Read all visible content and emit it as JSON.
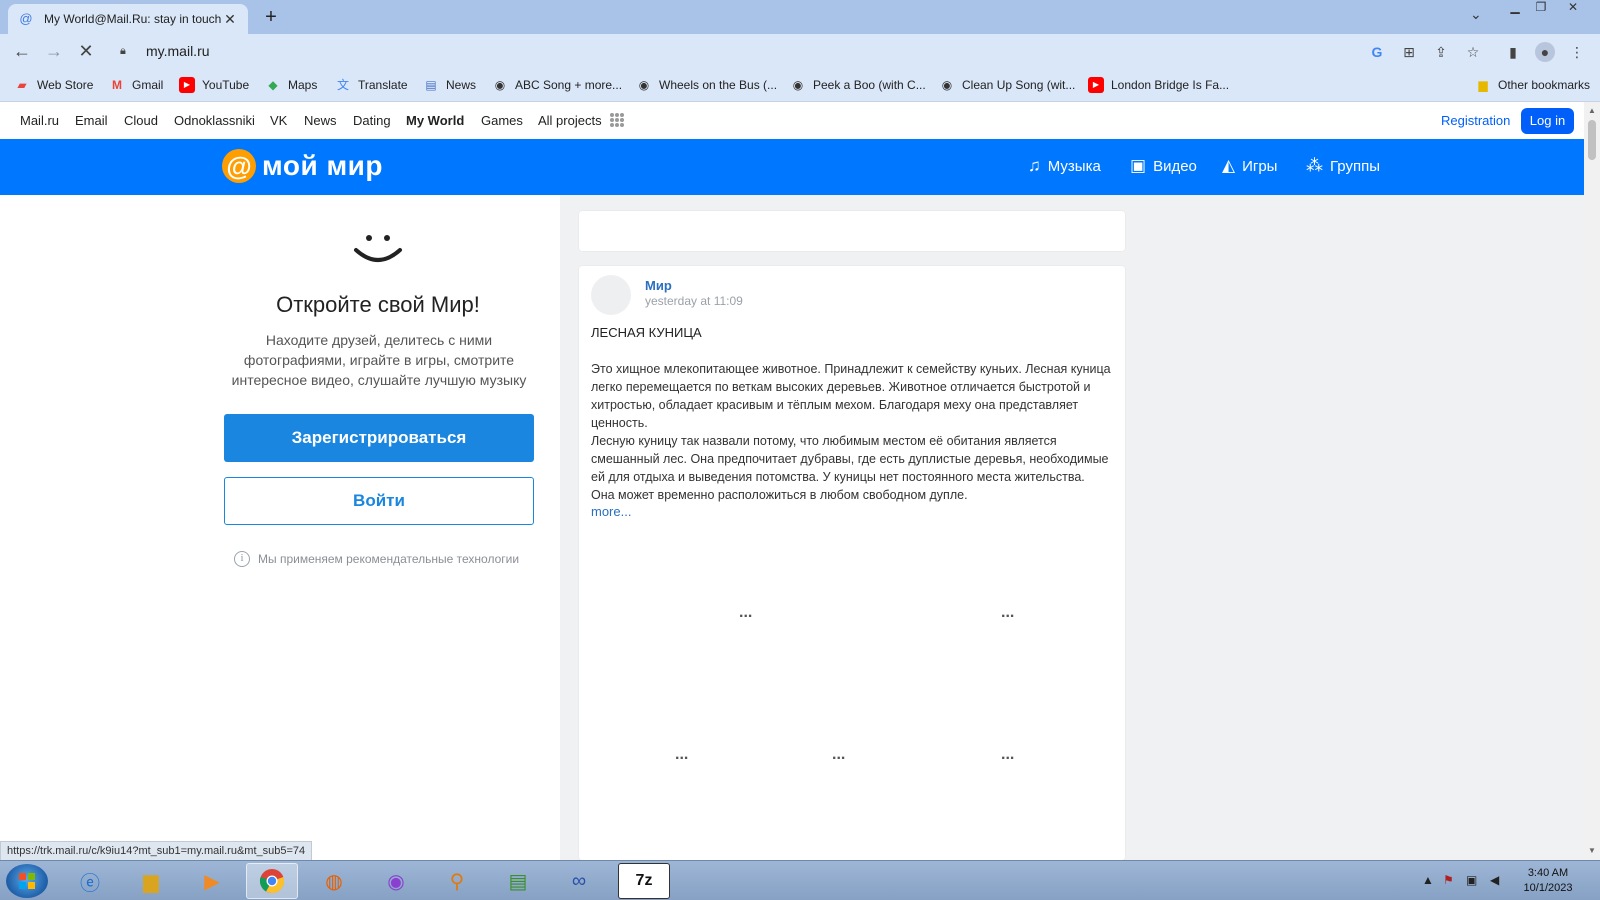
{
  "browser": {
    "tab_title": "My World@Mail.Ru: stay in touch",
    "url": "my.mail.ru",
    "bookmarks": [
      {
        "label": "Web Store",
        "icon": "web-store-icon"
      },
      {
        "label": "Gmail",
        "icon": "gmail-icon"
      },
      {
        "label": "YouTube",
        "icon": "youtube-icon"
      },
      {
        "label": "Maps",
        "icon": "maps-icon"
      },
      {
        "label": "Translate",
        "icon": "translate-icon"
      },
      {
        "label": "News",
        "icon": "news-icon"
      },
      {
        "label": "ABC Song + more...",
        "icon": "globe-icon"
      },
      {
        "label": "Wheels on the Bus (...",
        "icon": "globe-icon"
      },
      {
        "label": "Peek a Boo (with C...",
        "icon": "globe-icon"
      },
      {
        "label": "Clean Up Song (wit...",
        "icon": "globe-icon"
      },
      {
        "label": "London Bridge Is Fa...",
        "icon": "youtube-icon"
      }
    ],
    "other_bookmarks": "Other bookmarks",
    "status_url": "https://trk.mail.ru/c/k9iu14?mt_sub1=my.mail.ru&mt_sub5=74"
  },
  "portal": {
    "links": [
      "Mail.ru",
      "Email",
      "Cloud",
      "Odnoklassniki",
      "VK",
      "News",
      "Dating",
      "My World",
      "Games",
      "All projects"
    ],
    "registration": "Registration",
    "login": "Log in"
  },
  "header": {
    "logo_symbol": "@",
    "logo_text": "мой мир",
    "nav": [
      {
        "label": "Музыка",
        "icon": "music-note-icon"
      },
      {
        "label": "Видео",
        "icon": "video-icon"
      },
      {
        "label": "Игры",
        "icon": "gamepad-icon"
      },
      {
        "label": "Группы",
        "icon": "groups-icon"
      }
    ]
  },
  "promo": {
    "title": "Откройте свой Мир!",
    "text": "Находите друзей, делитесь с ними фотографиями, играйте в игры, смотрите интересное видео, слушайте лучшую музыку",
    "register_button": "Зарегистрироваться",
    "login_button": "Войти",
    "note": "Мы применяем рекомендательные технологии"
  },
  "post": {
    "author": "Мир",
    "time": "yesterday at 11:09",
    "title": "ЛЕСНАЯ КУНИЦА",
    "paragraph1": "Это хищное млекопитающее животное. Принадлежит к семейству куньих. Лесная куница легко перемещается по веткам высоких деревьев. Животное отличается быстротой и хитростью, обладает красивым и тёплым мехом. Благодаря меху она представляет ценность.",
    "paragraph2": "Лесную куницу так назвали потому, что любимым местом её обитания является смешанный лес. Она предпочитает дубравы, где есть дуплистые деревья, необходимые ей для отдыха и выведения потомства. У куницы нет постоянного места жительства. Она может временно расположиться в любом свободном дупле.",
    "more": "more...",
    "placeholder": "..."
  },
  "taskbar": {
    "time": "3:40 AM",
    "date": "10/1/2023"
  }
}
